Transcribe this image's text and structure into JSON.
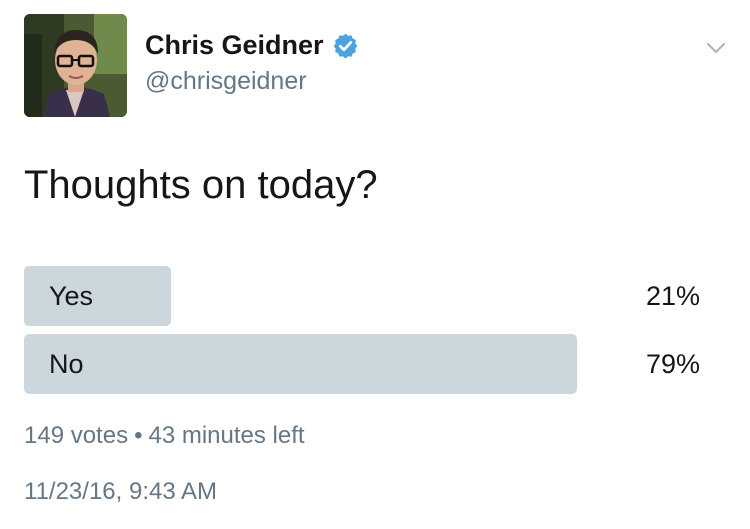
{
  "author": {
    "display_name": "Chris Geidner",
    "handle": "@chrisgeidner",
    "verified": true,
    "verified_color": "#4aa3df"
  },
  "tweet": {
    "text": "Thoughts on today?"
  },
  "poll": {
    "bar_color": "#ccd6dd",
    "options": [
      {
        "label": "Yes",
        "percent_text": "21%",
        "percent": 21
      },
      {
        "label": "No",
        "percent_text": "79%",
        "percent": 79
      }
    ],
    "votes": "149 votes",
    "separator": "•",
    "time_left": "43 minutes left"
  },
  "timestamp": "11/23/16, 9:43 AM",
  "icons": {
    "verified": "verified-badge-icon",
    "menu": "chevron-down-icon"
  }
}
